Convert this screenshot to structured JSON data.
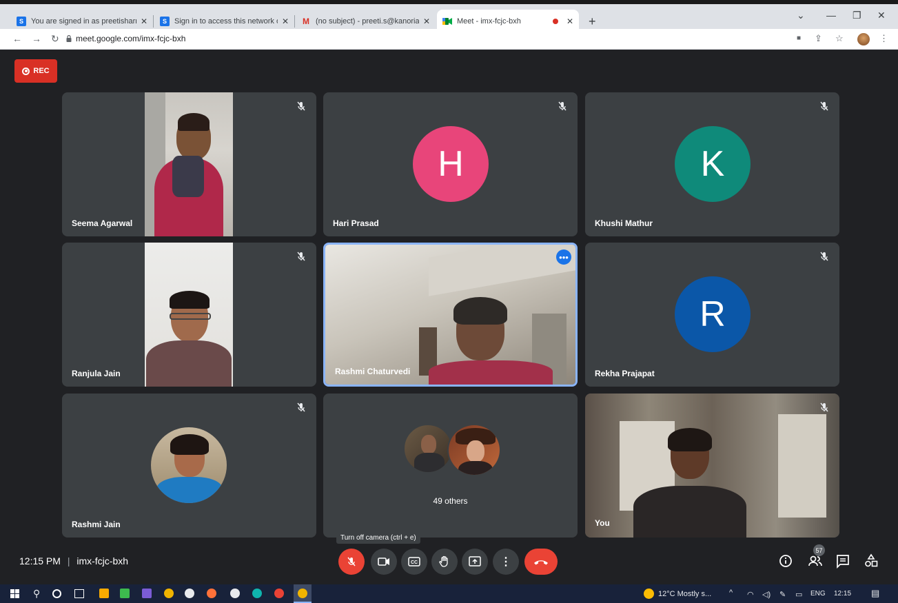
{
  "browser": {
    "tabs": [
      {
        "title": "You are signed in as preetisharm",
        "favicon": "S"
      },
      {
        "title": "Sign in to access this network or",
        "favicon": "S"
      },
      {
        "title": "(no subject) - preeti.s@kanoriac",
        "favicon": "M"
      },
      {
        "title": "Meet - imx-fcjc-bxh",
        "favicon": "meet-logo"
      }
    ],
    "new_tab": "+",
    "url": "meet.google.com/imx-fcjc-bxh"
  },
  "meet": {
    "rec_label": "REC",
    "participants": [
      {
        "name": "Seema Agarwal",
        "type": "video"
      },
      {
        "name": "Hari Prasad",
        "type": "letter",
        "letter": "H",
        "color": "#e8457a"
      },
      {
        "name": "Khushi Mathur",
        "type": "letter",
        "letter": "K",
        "color": "#0f8a7a"
      },
      {
        "name": "Ranjula Jain",
        "type": "video"
      },
      {
        "name": "Rashmi Chaturvedi",
        "type": "video",
        "active": true
      },
      {
        "name": "Rekha Prajapat",
        "type": "letter",
        "letter": "R",
        "color": "#0b57a8"
      },
      {
        "name": "Rashmi Jain",
        "type": "photo"
      },
      {
        "name": "49 others",
        "type": "others"
      },
      {
        "name": "You",
        "type": "video"
      }
    ],
    "time": "12:15 PM",
    "separator": "|",
    "meeting_code": "imx-fcjc-bxh",
    "tooltip": "Turn off camera (ctrl + e)",
    "participant_count": "57"
  },
  "taskbar": {
    "weather": "12°C  Mostly s...",
    "lang": "ENG",
    "clock": "12:15"
  },
  "colors": {
    "background": "#202124",
    "tile": "#3c4043",
    "red": "#ea4335",
    "active_border": "#8ab4f8"
  }
}
